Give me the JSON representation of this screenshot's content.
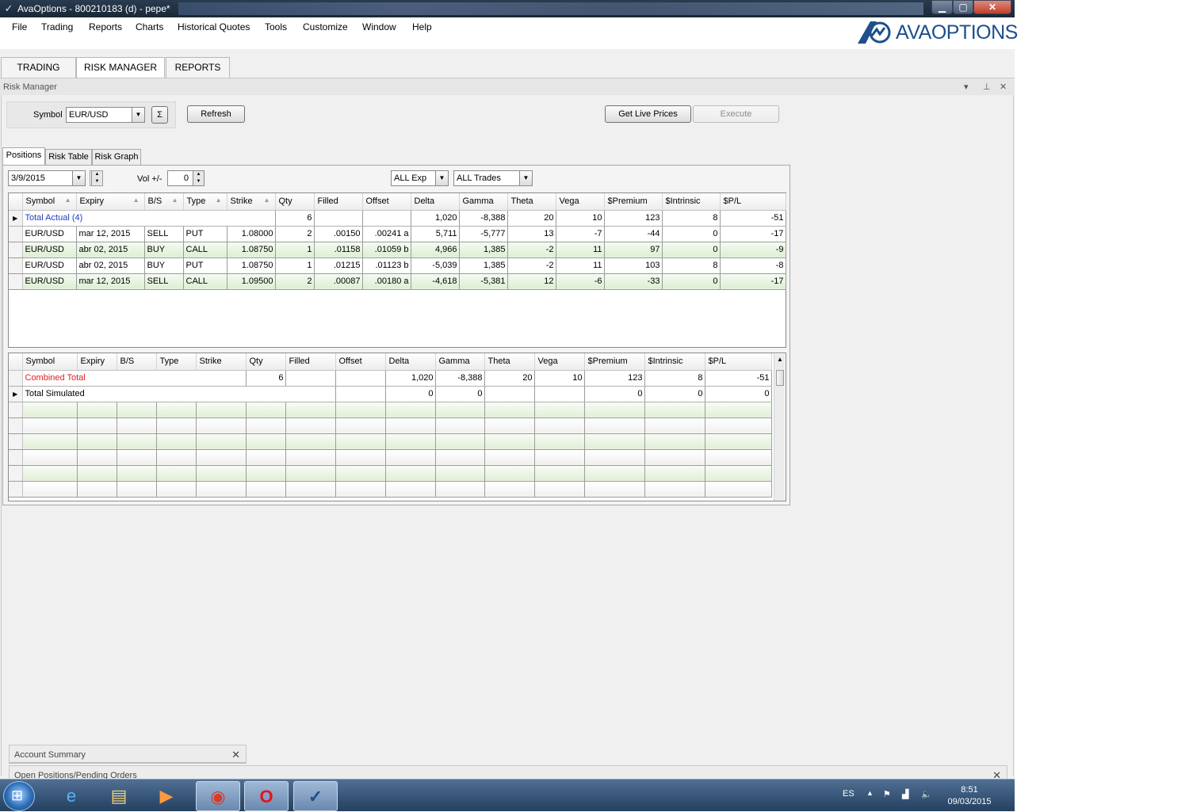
{
  "window": {
    "title": "AvaOptions - 800210183 (d) - pepe*",
    "app_icon": "avaoptions-logo-icon",
    "buttons": {
      "minimize": "▁",
      "maximize": "▢",
      "close": "✕"
    }
  },
  "menu": [
    "File",
    "Trading",
    "Reports",
    "Charts",
    "Historical Quotes",
    "Tools",
    "Customize",
    "Window",
    "Help"
  ],
  "logo": {
    "text": "AVAOPTIONS",
    "color": "#1d4f8c"
  },
  "main_tabs": [
    "TRADING",
    "RISK MANAGER",
    "REPORTS"
  ],
  "panel": {
    "title": "Risk Manager",
    "controls": {
      "dropdown": "▾",
      "pin": "⊥",
      "close": "✕"
    }
  },
  "toolbar": {
    "symbol_label": "Symbol",
    "symbol_value": "EUR/USD",
    "sigma": "Σ",
    "refresh": "Refresh",
    "get_live_prices": "Get Live Prices",
    "execute": "Execute"
  },
  "sub_tabs": [
    "Positions",
    "Risk Table",
    "Risk Graph"
  ],
  "filters": {
    "date": "3/9/2015",
    "vol_label": "Vol +/-",
    "vol_value": "0",
    "exp": "ALL Exp",
    "trades": "ALL Trades"
  },
  "positions_table": {
    "columns": [
      "Symbol",
      "Expiry",
      "B/S",
      "Type",
      "Strike",
      "Qty",
      "Filled",
      "Offset",
      "Delta",
      "Gamma",
      "Theta",
      "Vega",
      "$Premium",
      "$Intrinsic",
      "$P/L"
    ],
    "total": {
      "label": "Total Actual (4)",
      "qty": "6",
      "delta": "1,020",
      "gamma": "-8,388",
      "theta": "20",
      "vega": "10",
      "premium": "123",
      "intrinsic": "8",
      "pl": "-51"
    },
    "rows": [
      [
        "EUR/USD",
        "mar 12, 2015",
        "SELL",
        "PUT",
        "1.08000",
        "2",
        ".00150",
        ".00241 a",
        "5,711",
        "-5,777",
        "13",
        "-7",
        "-44",
        "0",
        "-17"
      ],
      [
        "EUR/USD",
        "abr 02, 2015",
        "BUY",
        "CALL",
        "1.08750",
        "1",
        ".01158",
        ".01059 b",
        "4,966",
        "1,385",
        "-2",
        "11",
        "97",
        "0",
        "-9"
      ],
      [
        "EUR/USD",
        "abr 02, 2015",
        "BUY",
        "PUT",
        "1.08750",
        "1",
        ".01215",
        ".01123 b",
        "-5,039",
        "1,385",
        "-2",
        "11",
        "103",
        "8",
        "-8"
      ],
      [
        "EUR/USD",
        "mar 12, 2015",
        "SELL",
        "CALL",
        "1.09500",
        "2",
        ".00087",
        ".00180 a",
        "-4,618",
        "-5,381",
        "12",
        "-6",
        "-33",
        "0",
        "-17"
      ]
    ]
  },
  "sim_table": {
    "columns": [
      "Symbol",
      "Expiry",
      "B/S",
      "Type",
      "Strike",
      "Qty",
      "Filled",
      "Offset",
      "Delta",
      "Gamma",
      "Theta",
      "Vega",
      "$Premium",
      "$Intrinsic",
      "$P/L"
    ],
    "combined": {
      "label": "Combined Total",
      "qty": "6",
      "delta": "1,020",
      "gamma": "-8,388",
      "theta": "20",
      "vega": "10",
      "premium": "123",
      "intrinsic": "8",
      "pl": "-51"
    },
    "simulated": {
      "label": "Total Simulated",
      "delta": "0",
      "gamma": "0",
      "premium": "0",
      "intrinsic": "0",
      "pl": "0"
    }
  },
  "bottom_panels": {
    "account_summary": "Account Summary",
    "open_positions": "Open Positions/Pending Orders",
    "close": "✕"
  },
  "taskbar": {
    "apps": [
      "internet-explorer-icon",
      "file-explorer-icon",
      "media-player-icon",
      "chrome-icon",
      "opera-icon",
      "avaoptions-icon"
    ],
    "language": "ES",
    "time": "8:51",
    "date": "09/03/2015"
  }
}
